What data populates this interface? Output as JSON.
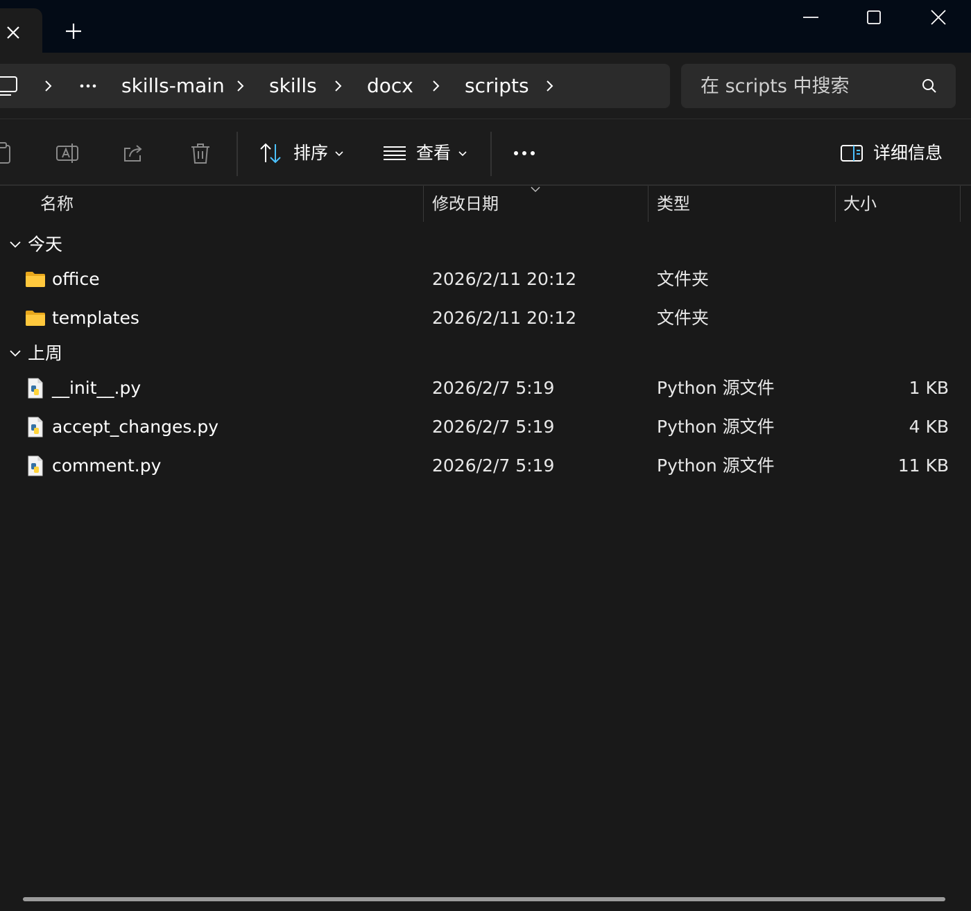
{
  "window": {
    "new_tab_label": "+"
  },
  "breadcrumb": {
    "items": [
      "skills-main",
      "skills",
      "docx",
      "scripts"
    ]
  },
  "search": {
    "placeholder": "在 scripts 中搜索"
  },
  "commandbar": {
    "sort_label": "排序",
    "view_label": "查看",
    "details_label": "详细信息"
  },
  "columns": {
    "name": "名称",
    "date": "修改日期",
    "type": "类型",
    "size": "大小"
  },
  "groups": [
    {
      "label": "今天",
      "items": [
        {
          "name": "office",
          "date": "2026/2/11 20:12",
          "type": "文件夹",
          "size": "",
          "icon": "folder-icon"
        },
        {
          "name": "templates",
          "date": "2026/2/11 20:12",
          "type": "文件夹",
          "size": "",
          "icon": "folder-icon"
        }
      ]
    },
    {
      "label": "上周",
      "items": [
        {
          "name": "__init__.py",
          "date": "2026/2/7 5:19",
          "type": "Python 源文件",
          "size": "1 KB",
          "icon": "python-file-icon"
        },
        {
          "name": "accept_changes.py",
          "date": "2026/2/7 5:19",
          "type": "Python 源文件",
          "size": "4 KB",
          "icon": "python-file-icon"
        },
        {
          "name": "comment.py",
          "date": "2026/2/7 5:19",
          "type": "Python 源文件",
          "size": "11 KB",
          "icon": "python-file-icon"
        }
      ]
    }
  ],
  "colors": {
    "background": "#191919",
    "titlebar": "#030b16",
    "accent": "#4cc2ff",
    "folder": "#ffc83d"
  }
}
